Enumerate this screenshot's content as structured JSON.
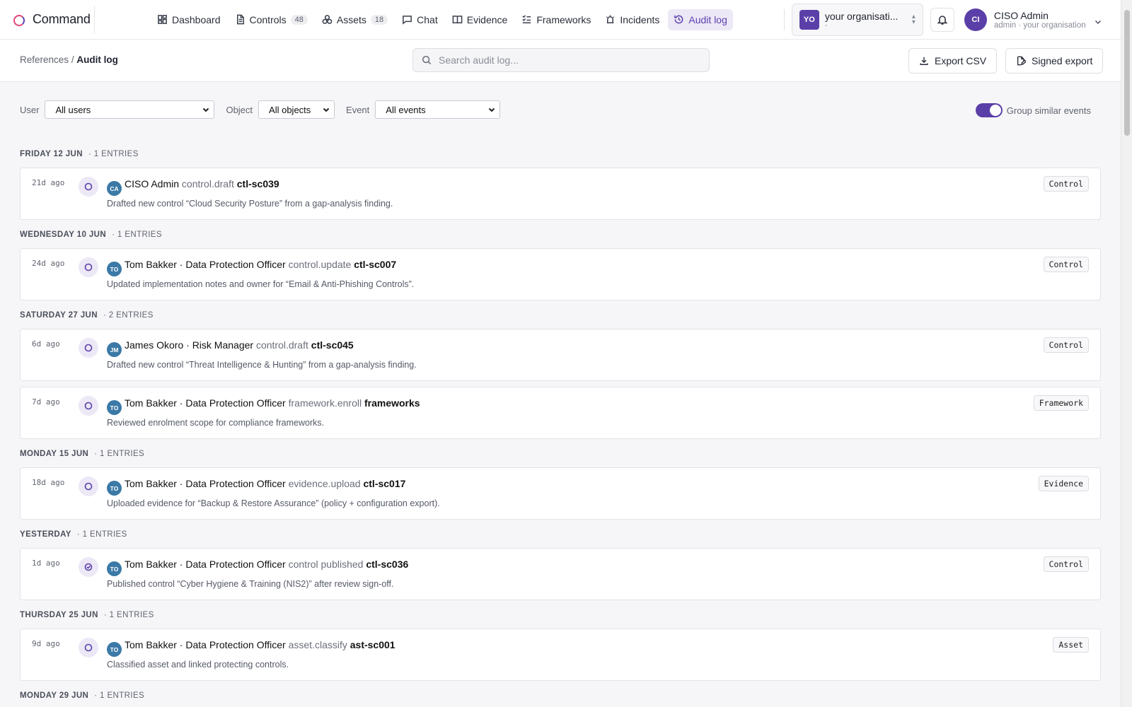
{
  "app": {
    "name": "Command"
  },
  "nav": [
    {
      "label": "Dashboard",
      "icon": "dashboard-icon",
      "count": ""
    },
    {
      "label": "Controls",
      "icon": "document-icon",
      "count": "48"
    },
    {
      "label": "Assets",
      "icon": "assets-icon",
      "count": "18"
    },
    {
      "label": "Chat",
      "icon": "chat-icon",
      "count": ""
    },
    {
      "label": "Evidence",
      "icon": "book-icon",
      "count": ""
    },
    {
      "label": "Frameworks",
      "icon": "list-check-icon",
      "count": ""
    },
    {
      "label": "Incidents",
      "icon": "alarm-icon",
      "count": ""
    },
    {
      "label": "Audit log",
      "icon": "history-icon",
      "count": "",
      "active": true
    }
  ],
  "org": {
    "avatar": "YO",
    "name": "your organisati...",
    "sub": "-"
  },
  "user": {
    "avatar": "CI",
    "name": "CISO Admin",
    "sub": "admin · your organisation"
  },
  "breadcrumb": {
    "parent": "References",
    "sep": "/",
    "current": "Audit log"
  },
  "search": {
    "placeholder": "Search audit log..."
  },
  "actions": {
    "export_csv": "Export CSV",
    "signed_export": "Signed export"
  },
  "filters": {
    "user_label": "User",
    "user_value": "All users",
    "object_label": "Object",
    "object_value": "All objects",
    "event_label": "Event",
    "event_value": "All events",
    "group_label": "Group similar events"
  },
  "groups": [
    {
      "day": "FRIDAY 12 JUN",
      "count": "· 1 ENTRIES",
      "entries": [
        {
          "ago": "21d ago",
          "initials": "CA",
          "who": "CISO Admin",
          "event": "control.draft",
          "object": "ctl-sc039",
          "desc": "Drafted new control “Cloud Security Posture” from a gap-analysis finding.",
          "tag": "Control",
          "status": "circle"
        }
      ]
    },
    {
      "day": "WEDNESDAY 10 JUN",
      "count": "· 1 ENTRIES",
      "entries": [
        {
          "ago": "24d ago",
          "initials": "TO",
          "who": "Tom Bakker · Data Protection Officer",
          "event": "control.update",
          "object": "ctl-sc007",
          "desc": "Updated implementation notes and owner for “Email & Anti-Phishing Controls”.",
          "tag": "Control",
          "status": "circle"
        }
      ]
    },
    {
      "day": "SATURDAY 27 JUN",
      "count": "· 2 ENTRIES",
      "entries": [
        {
          "ago": "6d ago",
          "initials": "JM",
          "who": "James Okoro · Risk Manager",
          "event": "control.draft",
          "object": "ctl-sc045",
          "desc": "Drafted new control “Threat Intelligence & Hunting” from a gap-analysis finding.",
          "tag": "Control",
          "status": "circle"
        },
        {
          "ago": "7d ago",
          "initials": "TO",
          "who": "Tom Bakker · Data Protection Officer",
          "event": "framework.enroll",
          "object": "frameworks",
          "desc": "Reviewed enrolment scope for compliance frameworks.",
          "tag": "Framework",
          "status": "circle"
        }
      ]
    },
    {
      "day": "MONDAY 15 JUN",
      "count": "· 1 ENTRIES",
      "entries": [
        {
          "ago": "18d ago",
          "initials": "TO",
          "who": "Tom Bakker · Data Protection Officer",
          "event": "evidence.upload",
          "object": "ctl-sc017",
          "desc": "Uploaded evidence for “Backup & Restore Assurance” (policy + configuration export).",
          "tag": "Evidence",
          "status": "circle"
        }
      ]
    },
    {
      "day": "YESTERDAY",
      "count": "· 1 ENTRIES",
      "entries": [
        {
          "ago": "1d ago",
          "initials": "TO",
          "who": "Tom Bakker · Data Protection Officer",
          "event": "control published",
          "object": "ctl-sc036",
          "desc": "Published control “Cyber Hygiene & Training (NIS2)” after review sign-off.",
          "tag": "Control",
          "status": "check"
        }
      ]
    },
    {
      "day": "THURSDAY 25 JUN",
      "count": "· 1 ENTRIES",
      "entries": [
        {
          "ago": "9d ago",
          "initials": "TO",
          "who": "Tom Bakker · Data Protection Officer",
          "event": "asset.classify",
          "object": "ast-sc001",
          "desc": "Classified asset and linked protecting controls.",
          "tag": "Asset",
          "status": "circle"
        }
      ]
    },
    {
      "day": "MONDAY 29 JUN",
      "count": "· 1 ENTRIES",
      "entries": []
    }
  ],
  "colors": {
    "accent": "#5b3fa8",
    "active_nav_bg": "#ece8f6",
    "avatar_blue": "#3b79a6"
  }
}
